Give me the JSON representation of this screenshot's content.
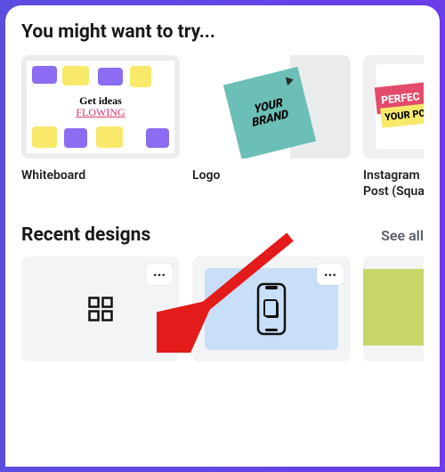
{
  "suggestions": {
    "title": "You might want to try...",
    "cards": [
      {
        "label": "Whiteboard",
        "caption_line1": "Get ideas",
        "caption_line2": "FLOWING"
      },
      {
        "label": "Logo",
        "caption_line1": "YOUR",
        "caption_line2": "BRAND"
      },
      {
        "label": "Instagram Post (Square)",
        "caption_line1": "PERFEC",
        "caption_line2": "YOUR PO"
      }
    ]
  },
  "recent": {
    "title": "Recent designs",
    "see_all": "See all",
    "items": [
      {
        "type": "whiteboard"
      },
      {
        "type": "mobile-prototype"
      },
      {
        "type": "presentation"
      }
    ],
    "more_glyph": "..."
  },
  "icons": {
    "close_x": "✕"
  }
}
